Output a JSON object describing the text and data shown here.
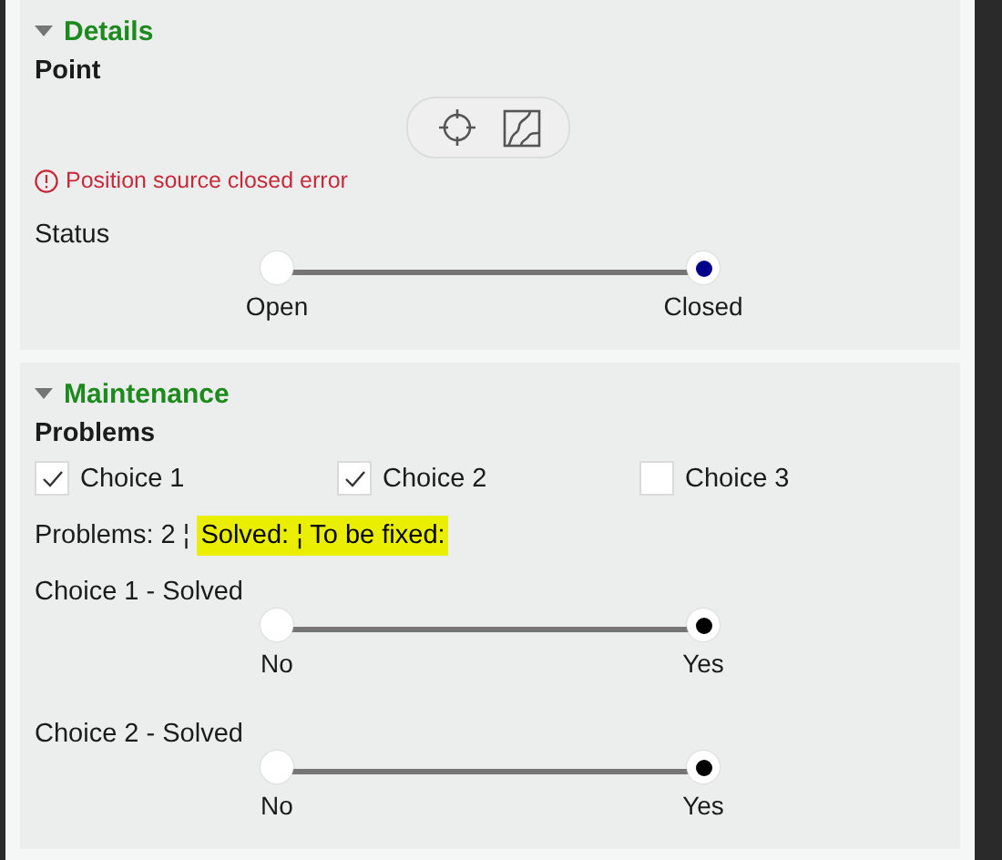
{
  "sections": [
    {
      "title": "Details",
      "expanded": true,
      "blocks": [
        {
          "kind": "heading",
          "text": "Point"
        },
        {
          "kind": "tools"
        },
        {
          "kind": "error",
          "text": "Position source closed error"
        },
        {
          "kind": "toggle",
          "label": "Status",
          "color": "#00008b",
          "options": [
            {
              "label": "Open",
              "selected": false
            },
            {
              "label": "Closed",
              "selected": true
            }
          ]
        }
      ]
    },
    {
      "title": "Maintenance",
      "expanded": true,
      "blocks": [
        {
          "kind": "heading",
          "text": "Problems"
        },
        {
          "kind": "checks",
          "items": [
            {
              "label": "Choice 1",
              "checked": true
            },
            {
              "label": "Choice 2",
              "checked": true
            },
            {
              "label": "Choice 3",
              "checked": false
            }
          ]
        },
        {
          "kind": "summary",
          "parts": [
            {
              "text": "Problems: 2 ¦",
              "highlighted": false
            },
            {
              "text": "Solved: ¦ To be fixed:",
              "highlighted": true
            }
          ]
        },
        {
          "kind": "toggle",
          "label": "Choice 1 - Solved",
          "color": "#000000",
          "options": [
            {
              "label": "No",
              "selected": false
            },
            {
              "label": "Yes",
              "selected": true
            }
          ]
        },
        {
          "kind": "toggle",
          "label": "Choice 2 - Solved",
          "color": "#000000",
          "options": [
            {
              "label": "No",
              "selected": false
            },
            {
              "label": "Yes",
              "selected": true
            }
          ]
        }
      ]
    }
  ]
}
